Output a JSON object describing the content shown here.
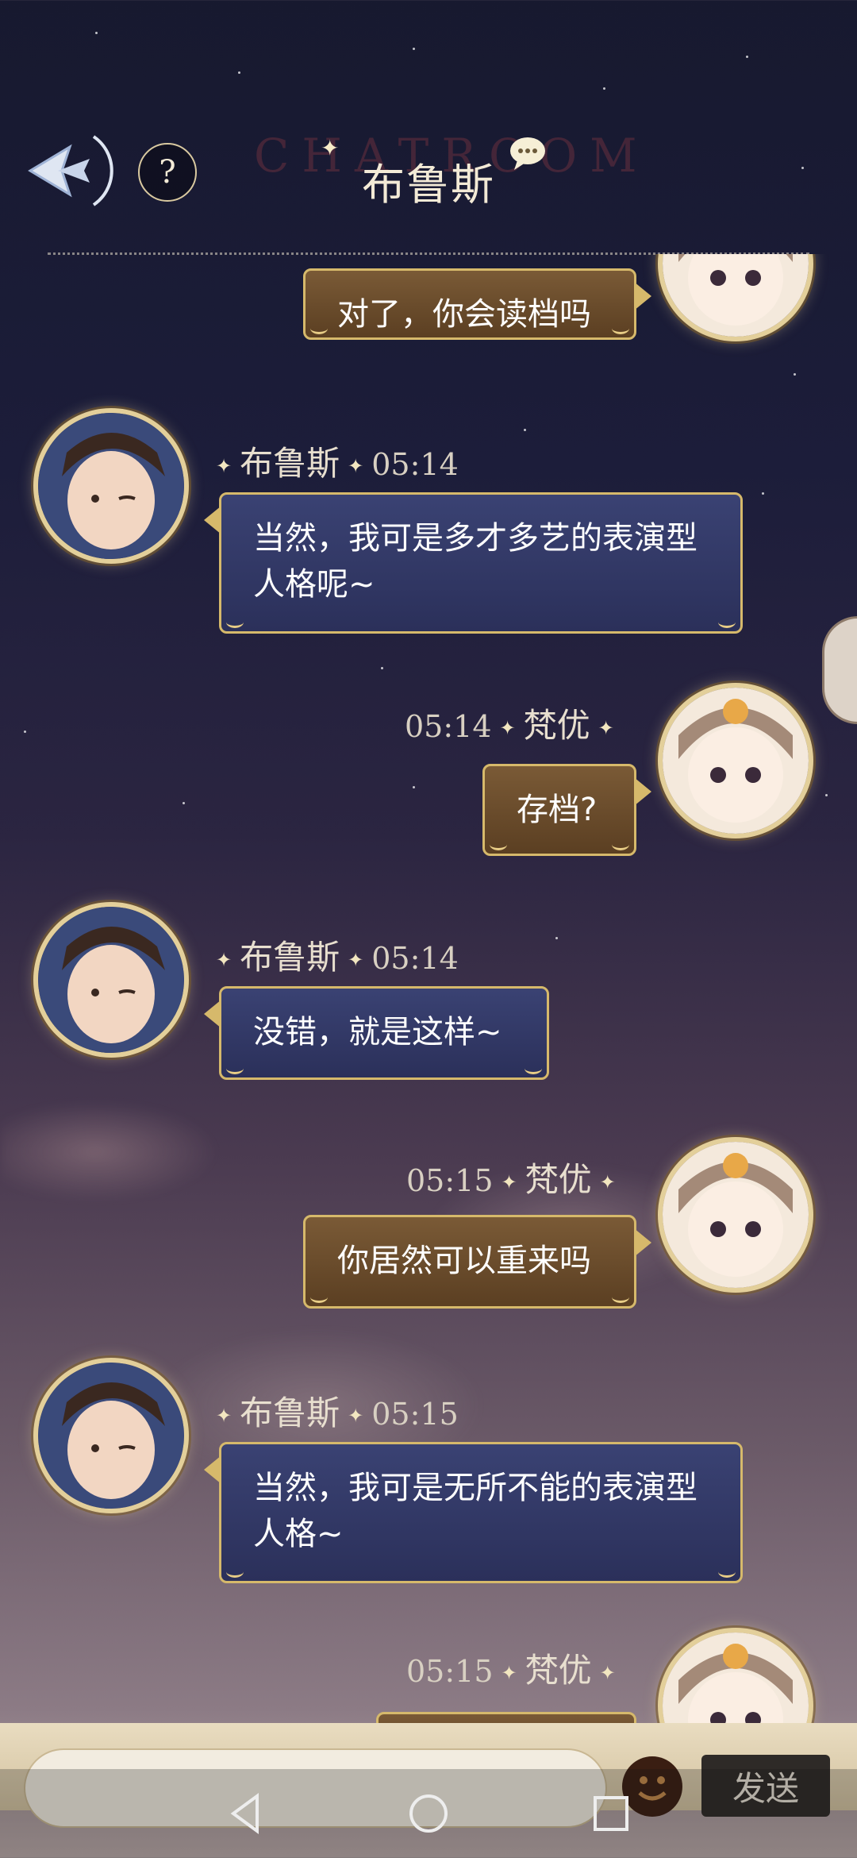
{
  "header": {
    "title": "布鲁斯",
    "watermark": "CHATROOM",
    "help_label": "?"
  },
  "messages": [
    {
      "side": "right",
      "text": "对了，你会读档吗",
      "partial": true
    },
    {
      "side": "left",
      "sender": "布鲁斯",
      "time": "05:14",
      "text": "当然，我可是多才多艺的表演型人格呢~"
    },
    {
      "side": "right",
      "sender": "梵优",
      "time": "05:14",
      "text": "存档?"
    },
    {
      "side": "left",
      "sender": "布鲁斯",
      "time": "05:14",
      "text": "没错，就是这样~"
    },
    {
      "side": "right",
      "sender": "梵优",
      "time": "05:15",
      "text": "你居然可以重来吗"
    },
    {
      "side": "left",
      "sender": "布鲁斯",
      "time": "05:15",
      "text": "当然，我可是无所不能的表演型人格~"
    },
    {
      "side": "right",
      "sender": "梵优",
      "time": "05:15",
      "text": "",
      "partial": true
    }
  ],
  "composer": {
    "placeholder": "",
    "send_label": "发送"
  },
  "colors": {
    "accent_gold": "#d6b96b",
    "bubble_blue": "#323a68",
    "bubble_brown": "#6b4c2c"
  }
}
